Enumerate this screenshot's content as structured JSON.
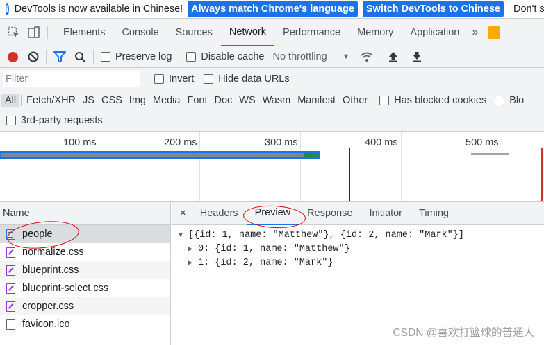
{
  "infobar": {
    "message": "DevTools is now available in Chinese!",
    "btn_match": "Always match Chrome's language",
    "btn_switch": "Switch DevTools to Chinese",
    "btn_dont": "Don't sh"
  },
  "tabs": [
    "Elements",
    "Console",
    "Sources",
    "Network",
    "Performance",
    "Memory",
    "Application"
  ],
  "active_tab": "Network",
  "toolbar": {
    "preserve_log": "Preserve log",
    "disable_cache": "Disable cache",
    "throttling": "No throttling"
  },
  "filter": {
    "placeholder": "Filter",
    "invert": "Invert",
    "hide_data_urls": "Hide data URLs"
  },
  "types": [
    "All",
    "Fetch/XHR",
    "JS",
    "CSS",
    "Img",
    "Media",
    "Font",
    "Doc",
    "WS",
    "Wasm",
    "Manifest",
    "Other"
  ],
  "has_blocked_cookies": "Has blocked cookies",
  "blocked_partial": "Blo",
  "third_party": "3rd-party requests",
  "timeline": {
    "ticks": [
      "100 ms",
      "200 ms",
      "300 ms",
      "400 ms",
      "500 ms"
    ]
  },
  "list": {
    "header": "Name",
    "requests": [
      {
        "name": "people",
        "type": "doc"
      },
      {
        "name": "normalize.css",
        "type": "css"
      },
      {
        "name": "blueprint.css",
        "type": "css"
      },
      {
        "name": "blueprint-select.css",
        "type": "css"
      },
      {
        "name": "cropper.css",
        "type": "css"
      },
      {
        "name": "favicon.ico",
        "type": "other"
      }
    ]
  },
  "detail": {
    "close": "×",
    "tabs": [
      "Headers",
      "Preview",
      "Response",
      "Initiator",
      "Timing"
    ],
    "active": "Preview",
    "preview": {
      "root": "[{id: 1, name: \"Matthew\"}, {id: 2, name: \"Mark\"}]",
      "items": [
        "0: {id: 1, name: \"Matthew\"}",
        "1: {id: 2, name: \"Mark\"}"
      ]
    }
  },
  "watermark": "CSDN @喜欢打篮球的普通人",
  "colors": {
    "accent": "#1a73e8",
    "record": "#d93025",
    "annotation": "#e00000"
  }
}
